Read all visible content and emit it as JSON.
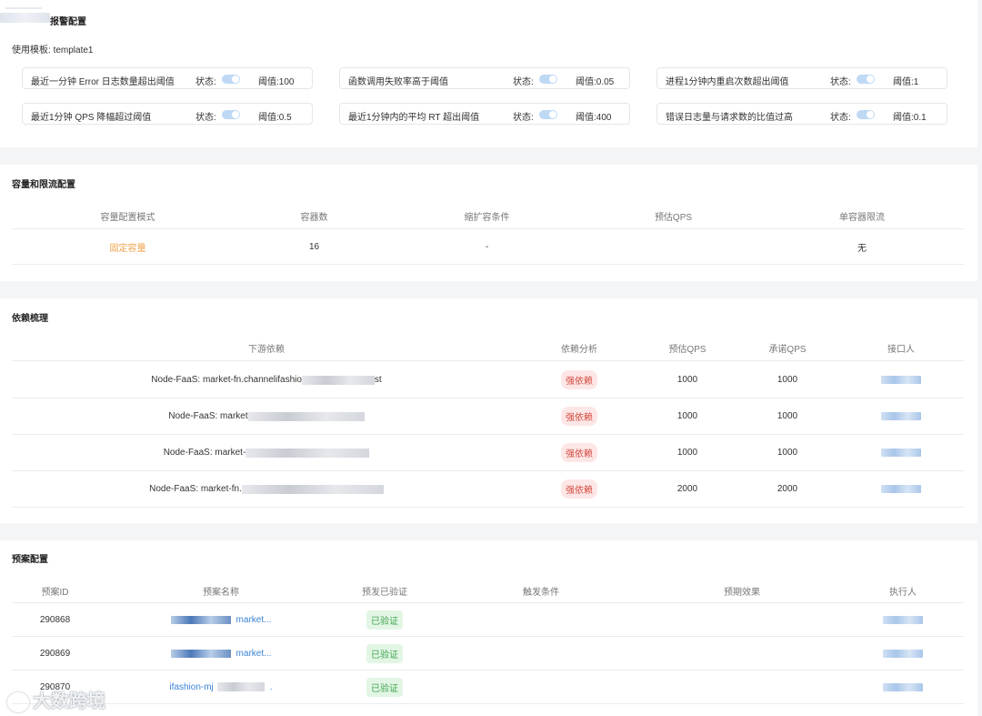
{
  "alarm": {
    "title": "报警配置",
    "template_label": "使用模板:",
    "template_value": "template1",
    "state_label": "状态:",
    "threshold_label": "阈值:",
    "rules": [
      {
        "name": "最近一分钟 Error 日志数量超出阈值",
        "enabled": true,
        "threshold": "100"
      },
      {
        "name": "函数调用失败率高于阈值",
        "enabled": true,
        "threshold": "0.05"
      },
      {
        "name": "进程1分钟内重启次数超出阈值",
        "enabled": true,
        "threshold": "1"
      },
      {
        "name": "最近1分钟 QPS 降幅超过阈值",
        "enabled": true,
        "threshold": "0.5"
      },
      {
        "name": "最近1分钟内的平均 RT 超出阈值",
        "enabled": true,
        "threshold": "400"
      },
      {
        "name": "错误日志量与请求数的比值过高",
        "enabled": true,
        "threshold": "0.1"
      }
    ]
  },
  "capacity": {
    "title": "容量和限流配置",
    "headers": [
      "容量配置模式",
      "容器数",
      "缩扩容条件",
      "预估QPS",
      "单容器限流"
    ],
    "row": {
      "mode": "固定容量",
      "containers": "16",
      "scale_condition": "-",
      "est_qps": "",
      "limit": "无"
    }
  },
  "dependency": {
    "title": "依赖梳理",
    "headers": [
      "下游依赖",
      "依赖分析",
      "预估QPS",
      "承诺QPS",
      "接口人"
    ],
    "rows": [
      {
        "prefix": "Node-FaaS: market-fn.channelifashio",
        "suffix": "st",
        "analysis": "强依赖",
        "est_qps": "1000",
        "promised_qps": "1000"
      },
      {
        "prefix": "Node-FaaS: market",
        "suffix": "",
        "analysis": "强依赖",
        "est_qps": "1000",
        "promised_qps": "1000"
      },
      {
        "prefix": "Node-FaaS: market-",
        "suffix": "",
        "analysis": "强依赖",
        "est_qps": "1000",
        "promised_qps": "1000"
      },
      {
        "prefix": "Node-FaaS: market-fn.",
        "suffix": "",
        "analysis": "强依赖",
        "est_qps": "2000",
        "promised_qps": "2000"
      }
    ]
  },
  "plan": {
    "title": "预案配置",
    "headers": [
      "预案ID",
      "预案名称",
      "预发已验证",
      "触发条件",
      "预期效果",
      "执行人"
    ],
    "rows": [
      {
        "id": "290868",
        "name_prefix": "",
        "name_suffix": "market...",
        "verified": "已验证"
      },
      {
        "id": "290869",
        "name_prefix": "",
        "name_suffix": "market...",
        "verified": "已验证"
      },
      {
        "id": "290870",
        "name_prefix": "ifashion-mj",
        "name_suffix": ".",
        "verified": "已验证"
      }
    ]
  },
  "watermark": "大数跨境",
  "colors": {
    "accent": "#f0a24c",
    "danger": "#d44b42",
    "success": "#41a64f",
    "link": "#3b82d6"
  }
}
